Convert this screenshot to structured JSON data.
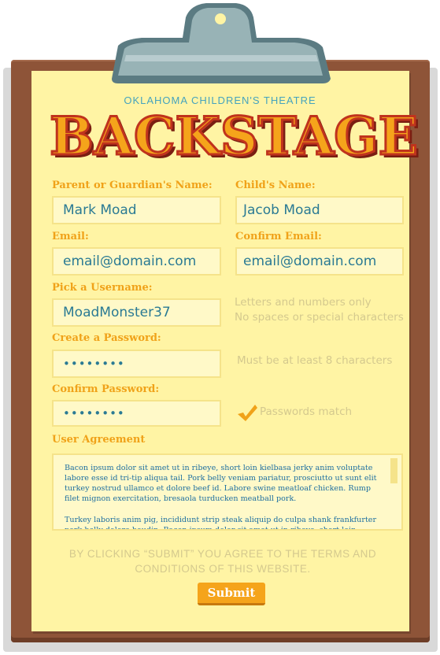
{
  "header": {
    "organization": "OKLAHOMA CHILDREN'S THEATRE",
    "logo_text": "BACKSTAGE"
  },
  "form": {
    "parent_name": {
      "label": "Parent or Guardian's Name:",
      "value": "Mark Moad"
    },
    "child_name": {
      "label": "Child's Name:",
      "value": "Jacob Moad"
    },
    "email": {
      "label": "Email:",
      "value": "email@domain.com"
    },
    "confirm_email": {
      "label": "Confirm Email:",
      "value": "email@domain.com"
    },
    "username": {
      "label": "Pick a Username:",
      "value": "MoadMonster37",
      "hint_line1": "Letters and numbers only",
      "hint_line2": "No spaces or special characters"
    },
    "password": {
      "label": "Create a Password:",
      "value": "••••••••",
      "hint": "Must be at least 8 characters"
    },
    "confirm_password": {
      "label": "Confirm Password:",
      "value": "••••••••",
      "status": "Passwords match"
    },
    "agreement": {
      "label": "User Agreement",
      "paragraphs": [
        "Bacon ipsum dolor sit amet ut in ribeye, short loin kielbasa jerky anim voluptate labore esse id tri-tip aliqua tail. Pork belly veniam pariatur, prosciutto ut sunt elit turkey nostrud ullamco et dolore beef id. Labore swine meatloaf chicken. Rump filet mignon exercitation, bresaola turducken meatball pork.",
        "Turkey laboris anim pig, incididunt strip steak aliquip do culpa shank frankfurter pork belly dolore boudin. Bacon ipsum dolor sit amet ut in ribeye, short loin"
      ]
    },
    "disclaimer": "BY CLICKING “SUBMIT” YOU AGREE TO THE TERMS AND CONDITIONS OF THIS WEBSITE.",
    "submit_label": "Submit"
  },
  "colors": {
    "paper": "#fff4a4",
    "board": "#8e5438",
    "label": "#f0a219",
    "field_text": "#2a7a94",
    "hint": "#d4c98e",
    "accent_blue": "#45a3be",
    "logo_fill": "#f5a41b",
    "logo_outline": "#c0331d"
  }
}
